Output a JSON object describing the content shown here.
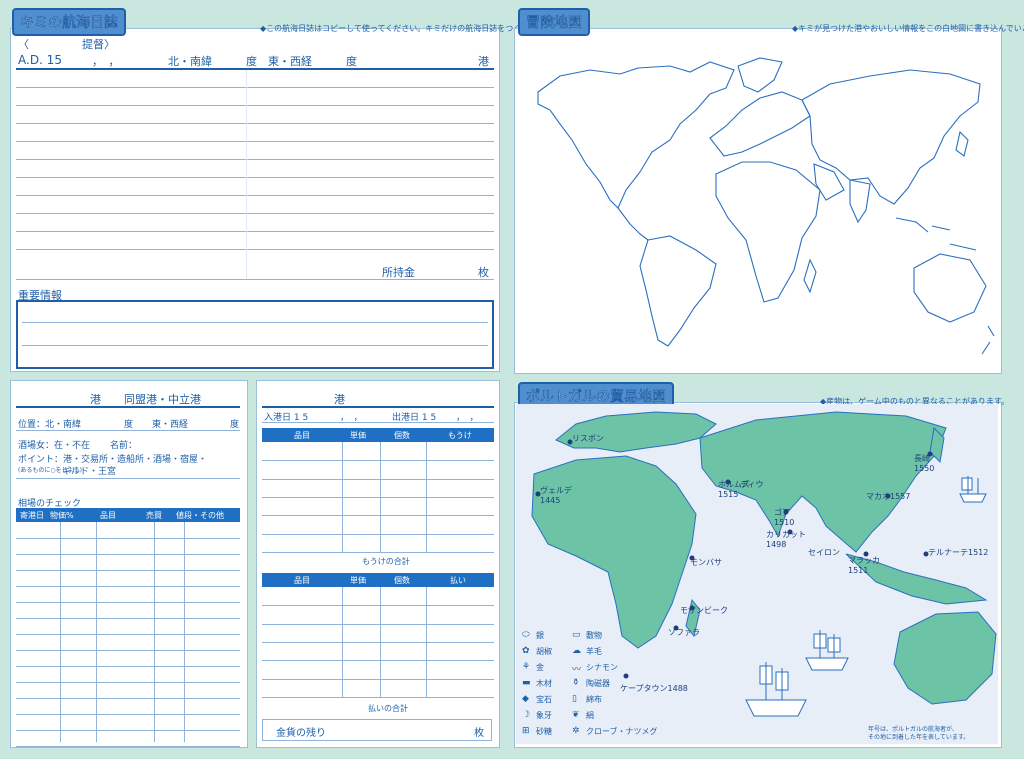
{
  "log": {
    "title": "キミの航海日誌",
    "note": "◆この航海日誌はコピーして使ってください。キミだけの航海日誌をつくろう!",
    "fleet_open": "〈",
    "fleet_label": "提督〉",
    "ad": "A.D. 15",
    "commas": "，　，",
    "lat": "北・南緯",
    "deg1": "度",
    "lon": "東・西経",
    "deg2": "度",
    "port": "港",
    "money": "所持金",
    "money_unit": "枚",
    "important": "重要情報"
  },
  "port_sheet": {
    "port": "港",
    "ally": "同盟港・中立港",
    "position": "位置：北・南緯",
    "deg1": "度",
    "lon": "東・西経",
    "deg2": "度",
    "barmaid": "酒場女：在・不在",
    "name": "名前：",
    "points": "ポイント：港・交易所・造船所・酒場・宿屋・",
    "points_sub": "(あるものに○をしよう)",
    "guild": "ギルド・王宮",
    "market_title": "相場のチェック",
    "market_headers": [
      "寄港日",
      "物価%",
      "品目",
      "売買",
      "値段・その他"
    ]
  },
  "trade_sheet": {
    "port": "港",
    "arrive": "入港日 1 5",
    "arrive_commas": "，　，",
    "depart": "出港日 1 5",
    "depart_commas": "，　，",
    "sales_headers": [
      "品目",
      "単価",
      "個数",
      "もうけ"
    ],
    "sales_total": "もうけの合計",
    "buy_headers": [
      "品目",
      "単価",
      "個数",
      "払い"
    ],
    "buy_total": "払いの合計",
    "gold_left": "金貨の残り",
    "gold_unit": "枚"
  },
  "adventure_map": {
    "title": "冒険地図",
    "note": "◆キミが見つけた港やおいしい情報をこの白地図に書き込んでいこう。"
  },
  "trade_map": {
    "title": "ポルトガルの貿易地図",
    "note": "◆産物は、ゲーム中のものと異なることがあります。",
    "cities": [
      {
        "name": "リスボン",
        "year": ""
      },
      {
        "name": "ヴェルデ",
        "year": "1445"
      },
      {
        "name": "ホルムズ",
        "year": "1515"
      },
      {
        "name": "ディウ",
        "year": ""
      },
      {
        "name": "ゴア",
        "year": "1510"
      },
      {
        "name": "カリカット",
        "year": "1498"
      },
      {
        "name": "セイロン",
        "year": ""
      },
      {
        "name": "マラッカ",
        "year": "1511"
      },
      {
        "name": "マカオ",
        "year": "1557"
      },
      {
        "name": "長崎",
        "year": "1550"
      },
      {
        "name": "テルナーテ",
        "year": "1512"
      },
      {
        "name": "モンバサ",
        "year": ""
      },
      {
        "name": "モザンビーク",
        "year": ""
      },
      {
        "name": "ソファラ",
        "year": ""
      },
      {
        "name": "ケープタウン",
        "year": "1488"
      }
    ],
    "legend": [
      {
        "icon": "silver-icon",
        "label": "銀"
      },
      {
        "icon": "textile-icon",
        "label": "敷物"
      },
      {
        "icon": "pepper-icon",
        "label": "胡椒"
      },
      {
        "icon": "wool-icon",
        "label": "羊毛"
      },
      {
        "icon": "gold-icon",
        "label": "金"
      },
      {
        "icon": "cinnamon-icon",
        "label": "シナモン"
      },
      {
        "icon": "timber-icon",
        "label": "木材"
      },
      {
        "icon": "porcelain-icon",
        "label": "陶磁器"
      },
      {
        "icon": "gem-icon",
        "label": "宝石"
      },
      {
        "icon": "cotton-icon",
        "label": "綿布"
      },
      {
        "icon": "ivory-icon",
        "label": "象牙"
      },
      {
        "icon": "silk-icon",
        "label": "絹"
      },
      {
        "icon": "sugar-icon",
        "label": "砂糖"
      },
      {
        "icon": "clove-icon",
        "label": "クローブ・ナツメグ"
      }
    ],
    "footnote1": "年号は、ポルトガルの航海者が、",
    "footnote2": "その地に到着した年を表しています。",
    "land_color": "#6cc3a6",
    "sea_color": "#e7eef8"
  }
}
